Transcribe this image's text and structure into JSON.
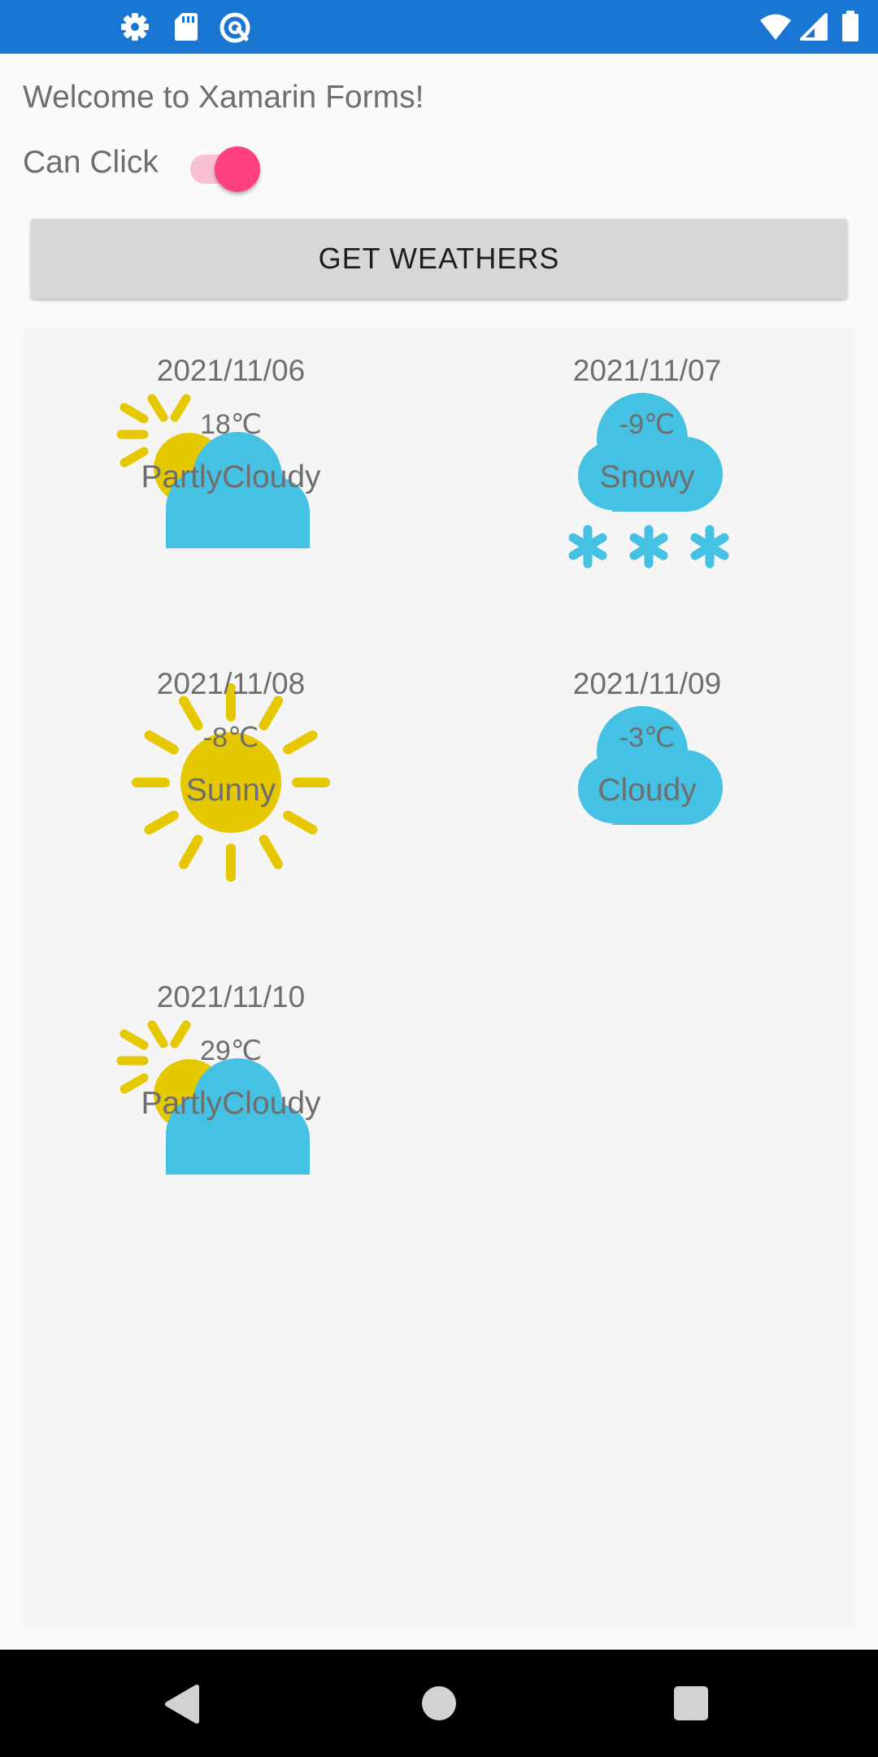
{
  "status_bar": {
    "left_icons": [
      "gear-icon",
      "sd-card-icon",
      "at-sign-icon"
    ],
    "right_icons": [
      "wifi-icon",
      "signal-icon",
      "battery-icon"
    ]
  },
  "welcome_text": "Welcome to Xamarin Forms!",
  "can_click": {
    "label": "Can Click",
    "on": true
  },
  "get_weathers_button": "GET WEATHERS",
  "weathers": [
    {
      "date": "2021/11/06",
      "temperature": "18℃",
      "condition": "PartlyCloudy",
      "icon": "partly-cloudy-icon"
    },
    {
      "date": "2021/11/07",
      "temperature": "-9℃",
      "condition": "Snowy",
      "icon": "snowy-icon"
    },
    {
      "date": "2021/11/08",
      "temperature": "-8℃",
      "condition": "Sunny",
      "icon": "sunny-icon"
    },
    {
      "date": "2021/11/09",
      "temperature": "-3℃",
      "condition": "Cloudy",
      "icon": "cloudy-icon"
    },
    {
      "date": "2021/11/10",
      "temperature": "29℃",
      "condition": "PartlyCloudy",
      "icon": "partly-cloudy-icon"
    }
  ],
  "nav_bar": [
    "back-icon",
    "home-icon",
    "recents-icon"
  ],
  "colors": {
    "status_bar": "#1976d2",
    "switch_thumb": "#ff4081",
    "switch_track": "#f9bfd3",
    "sun": "#e6c800",
    "cloud": "#45c2e3",
    "button": "#d6d7d7"
  }
}
